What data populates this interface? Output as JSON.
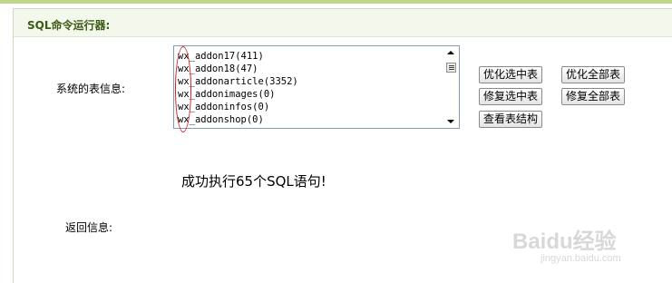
{
  "panel": {
    "title": "SQL命令运行器:"
  },
  "table_info": {
    "label": "系统的表信息:",
    "items": [
      "wx_addon17(411)",
      "wx_addon18(47)",
      "wx_addonarticle(3352)",
      "wx_addonimages(0)",
      "wx_addoninfos(0)",
      "wx_addonshop(0)"
    ]
  },
  "buttons": {
    "optimize_selected": "优化选中表",
    "optimize_all": "优化全部表",
    "repair_selected": "修复选中表",
    "repair_all": "修复全部表",
    "view_structure": "查看表结构"
  },
  "result": {
    "message": "成功执行65个SQL语句!"
  },
  "return_info": {
    "label": "返回信息:"
  },
  "watermark": {
    "brand": "Baidu经验",
    "url": "jingyan.baidu.com"
  },
  "colors": {
    "title": "#3b5a12",
    "header_bg": "#f4f8ec",
    "top_bar": "#bfd78a",
    "annotation": "#cc2222"
  }
}
